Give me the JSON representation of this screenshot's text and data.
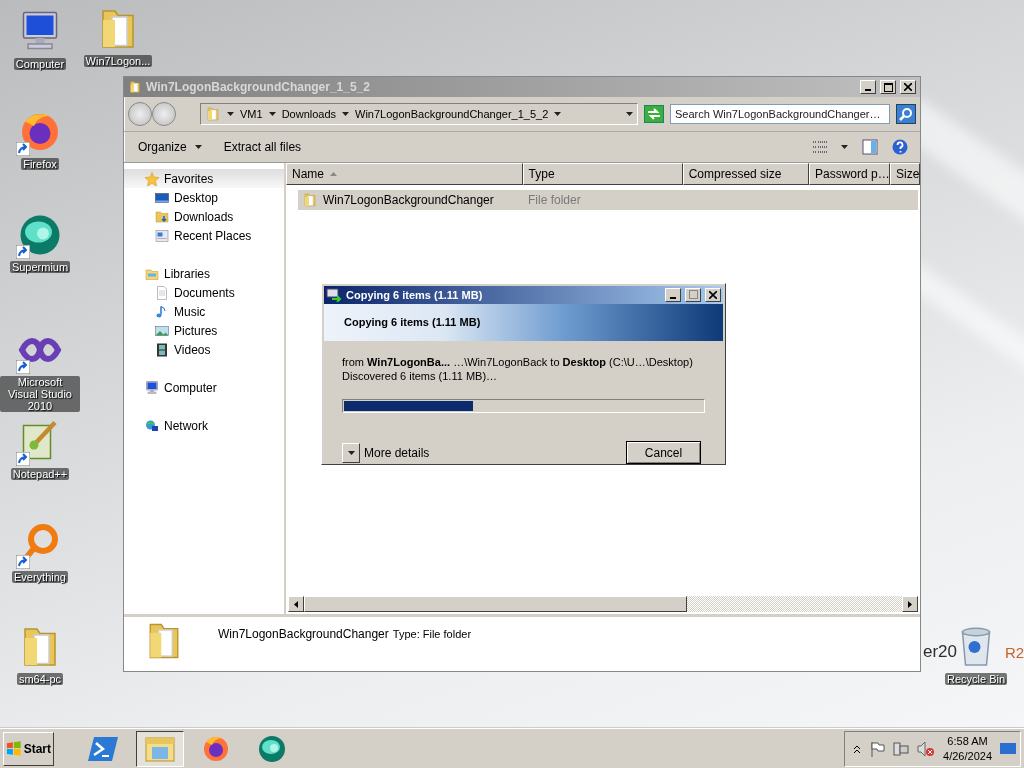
{
  "desktop": {
    "icons": [
      {
        "label": "Computer",
        "kind": "computer",
        "shortcut": false
      },
      {
        "label": "Win7Logon...",
        "kind": "folder",
        "shortcut": false
      },
      {
        "label": "Firefox",
        "kind": "firefox",
        "shortcut": true
      },
      {
        "label": "Supermium",
        "kind": "supermium",
        "shortcut": true
      },
      {
        "label": "Microsoft Visual Studio 2010",
        "kind": "vs",
        "shortcut": true
      },
      {
        "label": "Notepad++",
        "kind": "notepad",
        "shortcut": true
      },
      {
        "label": "Everything",
        "kind": "everything",
        "shortcut": true
      },
      {
        "label": "sm64-pc",
        "kind": "folder",
        "shortcut": false
      },
      {
        "label": "Recycle Bin",
        "kind": "recycle",
        "shortcut": false
      }
    ],
    "wallpaper_text": [
      "er20",
      "R2"
    ]
  },
  "explorer": {
    "title": "Win7LogonBackgroundChanger_1_5_2",
    "breadcrumb": [
      "VM1",
      "Downloads",
      "Win7LogonBackgroundChanger_1_5_2"
    ],
    "search": {
      "placeholder": "Search Win7LogonBackgroundChanger…"
    },
    "toolbar": [
      {
        "label": "Organize",
        "dropdown": true
      },
      {
        "label": "Extract all files",
        "dropdown": false
      }
    ],
    "nav": [
      {
        "label": "Favorites",
        "kind": "star",
        "selected": true,
        "children": [
          {
            "label": "Desktop",
            "kind": "desktop",
            "selected": false
          },
          {
            "label": "Downloads",
            "kind": "downloads",
            "selected": false
          },
          {
            "label": "Recent Places",
            "kind": "recent",
            "selected": false
          }
        ]
      },
      {
        "label": "Libraries",
        "kind": "libraries",
        "selected": false,
        "children": [
          {
            "label": "Documents",
            "kind": "documents",
            "selected": false
          },
          {
            "label": "Music",
            "kind": "music",
            "selected": false
          },
          {
            "label": "Pictures",
            "kind": "pictures",
            "selected": false
          },
          {
            "label": "Videos",
            "kind": "videos",
            "selected": false
          }
        ]
      },
      {
        "label": "Computer",
        "kind": "computer",
        "selected": false
      },
      {
        "label": "Network",
        "kind": "network",
        "selected": false
      }
    ],
    "columns": [
      "Name",
      "Type",
      "Compressed size",
      "Password p…",
      "Size"
    ],
    "rows": [
      {
        "name": "Win7LogonBackgroundChanger",
        "type": "File folder",
        "selected": true
      }
    ],
    "details": {
      "name": "Win7LogonBackgroundChanger",
      "info": "Type: File folder"
    }
  },
  "copy_dialog": {
    "title": "Copying 6 items (1.11 MB)",
    "heading": "Copying 6 items (1.11 MB)",
    "from_line": "from **Win7LogonBa...**  …\\Win7LogonBack to **Desktop** (C:\\U…\\Desktop)",
    "status": "Discovered 6 items (1.11 MB)…",
    "level": 0.36,
    "more_details": "More details",
    "cancel": "Cancel"
  },
  "taskbar": {
    "start": "Start",
    "apps": [
      {
        "kind": "powershell",
        "selected": false
      },
      {
        "kind": "explorer",
        "selected": true
      },
      {
        "kind": "firefox",
        "selected": false
      },
      {
        "kind": "supermium",
        "selected": false
      }
    ],
    "time": "6:58 AM",
    "date": "4/26/2024"
  }
}
